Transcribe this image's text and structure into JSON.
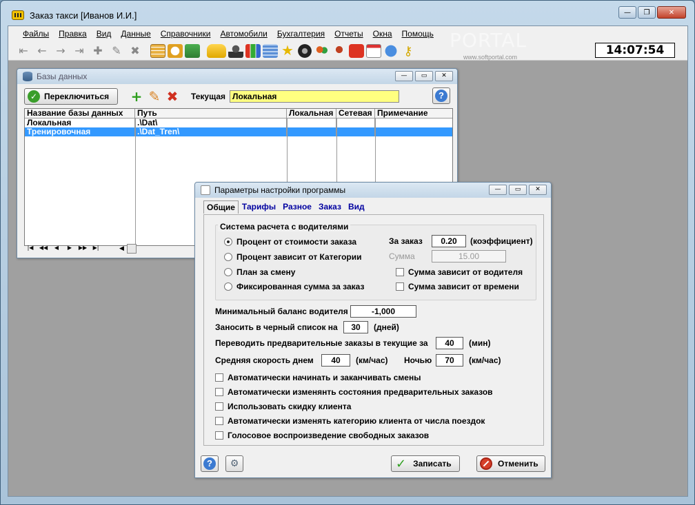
{
  "window": {
    "title": "Заказ такси  [Иванов И.И.]",
    "min": "—",
    "max": "❐",
    "close": "✕"
  },
  "menu": [
    "Файлы",
    "Правка",
    "Вид",
    "Данные",
    "Справочники",
    "Автомобили",
    "Бухгалтерия",
    "Отчеты",
    "Окна",
    "Помощь"
  ],
  "clock": "14:07:54",
  "watermark": "PORTAL",
  "watermark_url": "www.softportal.com",
  "db_window": {
    "title": "Базы данных",
    "switch_label": "Переключиться",
    "current_label": "Текущая",
    "current_value": "Локальная",
    "columns": [
      "Название базы данных",
      "Путь",
      "Локальная",
      "Сетевая",
      "Примечание"
    ],
    "rows": [
      {
        "name": "Локальная",
        "path": ".\\Dat\\",
        "local": "",
        "network": "",
        "note": ""
      },
      {
        "name": "Тренировочная",
        "path": ".\\Dat_Tren\\",
        "local": "",
        "network": "",
        "note": ""
      }
    ],
    "selected_row": 1
  },
  "settings": {
    "title": "Параметры настройки программы",
    "tabs": [
      "Общие",
      "Тарифы",
      "Разное",
      "Заказ",
      "Вид"
    ],
    "active_tab": 0,
    "group_title": "Система расчета с водителями",
    "radios": [
      {
        "label": "Процент от стоимости заказа",
        "checked": true
      },
      {
        "label": "Процент зависит от Категории",
        "checked": false
      },
      {
        "label": "План за смену",
        "checked": false
      },
      {
        "label": "Фиксированная сумма за заказ",
        "checked": false
      }
    ],
    "per_order_label": "За заказ",
    "per_order_value": "0.20",
    "coefficient_label": "(коэффициент)",
    "sum_label": "Сумма",
    "sum_value": "15.00",
    "sum_depends_driver": "Сумма зависит от водителя",
    "sum_depends_time": "Сумма зависит от времени",
    "min_balance_label": "Минимальный баланс водителя",
    "min_balance_value": "-1,000",
    "blacklist_label": "Заносить в черный список на",
    "blacklist_value": "30",
    "blacklist_unit": "(дней)",
    "prelim_label": "Переводить предварительные заказы в текущие за",
    "prelim_value": "40",
    "prelim_unit": "(мин)",
    "speed_day_label": "Средняя скорость днем",
    "speed_day_value": "40",
    "speed_unit": "(км/час)",
    "speed_night_label": "Ночью",
    "speed_night_value": "70",
    "speed_night_unit": "(км/час)",
    "checkboxes": [
      "Автоматически начинать и заканчивать смены",
      "Автоматически изменянть состояния предварительных заказов",
      "Использовать скидку клиента",
      "Автоматически изменять категорию клиента от числа поездок",
      "Голосовое воспроизведение свободных заказов"
    ],
    "save_label": "Записать",
    "cancel_label": "Отменить"
  },
  "icons": {
    "help": "?"
  }
}
